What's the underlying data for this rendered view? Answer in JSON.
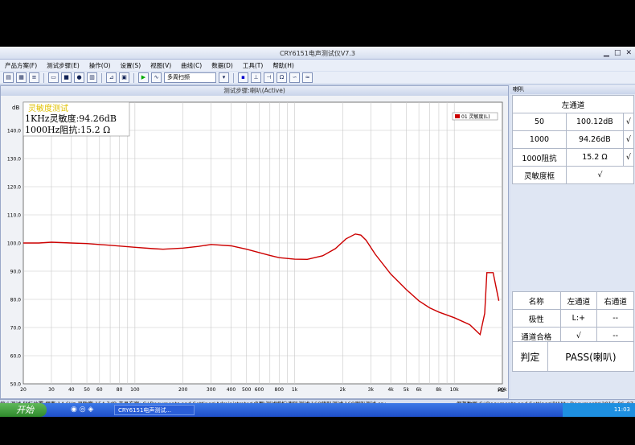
{
  "window": {
    "title": "CRY6151电声测试仪V7.3"
  },
  "menu": [
    "产品方案(F)",
    "测试步骤(E)",
    "操作(O)",
    "设置(S)",
    "视图(V)",
    "曲线(C)",
    "数据(D)",
    "工具(T)",
    "帮助(H)"
  ],
  "toolbar": {
    "mode": "多周扫频"
  },
  "chart_window": {
    "caption": "测试步骤:喇叭(Active)",
    "overlay_title": "灵敏度测试",
    "overlay_line1": "1KHz灵敏度:94.26dB",
    "overlay_line2": "1000Hz阻抗:15.2  Ω",
    "legend": "01 灵敏度(L)",
    "y_unit": "dB",
    "x_unit": "Hz"
  },
  "chart_data": {
    "type": "line",
    "xscale": "log",
    "xlim": [
      20,
      20000
    ],
    "ylim": [
      50,
      150
    ],
    "ylabel": "dB",
    "xlabel": "Hz",
    "yticks": [
      "140.0",
      "130.0",
      "120.0",
      "110.0",
      "100.0",
      "90.0",
      "80.0",
      "70.0",
      "60.0",
      "50.0"
    ],
    "xticks": [
      "20",
      "30",
      "40",
      "50",
      "60",
      "80",
      "100",
      "200",
      "300",
      "400",
      "500",
      "600",
      "800",
      "1k",
      "2k",
      "3k",
      "4k",
      "5k",
      "6k",
      "8k",
      "10k",
      "20k"
    ],
    "series": [
      {
        "name": "01 灵敏度(L)",
        "color": "#cc0000",
        "x": [
          20,
          25,
          30,
          40,
          50,
          70,
          100,
          130,
          150,
          200,
          250,
          300,
          400,
          500,
          700,
          800,
          1000,
          1200,
          1500,
          1800,
          2100,
          2400,
          2600,
          2800,
          3200,
          4000,
          5000,
          6000,
          7000,
          8000,
          10000,
          12500,
          14500,
          15500,
          16000,
          17500,
          19000
        ],
        "y": [
          100.0,
          100.0,
          100.3,
          100.0,
          99.8,
          99.2,
          98.5,
          98.0,
          97.8,
          98.2,
          98.8,
          99.5,
          99.0,
          97.8,
          95.6,
          94.8,
          94.26,
          94.2,
          95.5,
          98.0,
          101.5,
          103.2,
          102.8,
          101.0,
          96.0,
          89.0,
          83.5,
          79.5,
          77.0,
          75.5,
          73.5,
          71.0,
          67.5,
          75.0,
          89.5,
          89.5,
          79.5
        ]
      }
    ]
  },
  "right_panel": {
    "caption": "喇叭",
    "table1": {
      "header": "左通道",
      "rows": [
        [
          "50",
          "100.12dB",
          "√"
        ],
        [
          "1000",
          "94.26dB",
          "√"
        ],
        [
          "1000阻抗",
          "15.2  Ω",
          "√"
        ]
      ],
      "frame_row": [
        "灵敏度框",
        "√"
      ]
    },
    "table2": {
      "headers": [
        "名称",
        "左通道",
        "右通道"
      ],
      "rows": [
        [
          "极性",
          "L:+",
          "--"
        ],
        [
          "通道合格",
          "√",
          "--"
        ]
      ]
    },
    "verdict": {
      "label": "判定",
      "value": "PASS(喇叭)"
    }
  },
  "statusbar": {
    "text": "停止测试  鼠标位置:频率:14.6Hz 灵敏度:154.7dB   产品方案: C:\\Documents and Settings\\Administrator\\桌面\\测试模板\\喇叭测试\\16O喇叭测试\\16O喇叭测试.cry",
    "right": "保存数据:C:\\Documents and Settings\\BJJ\\My Documents\\2016_06_07"
  },
  "taskbar": {
    "start": "开始",
    "item": "CRY6151电声测试...",
    "clock": "11:03"
  }
}
